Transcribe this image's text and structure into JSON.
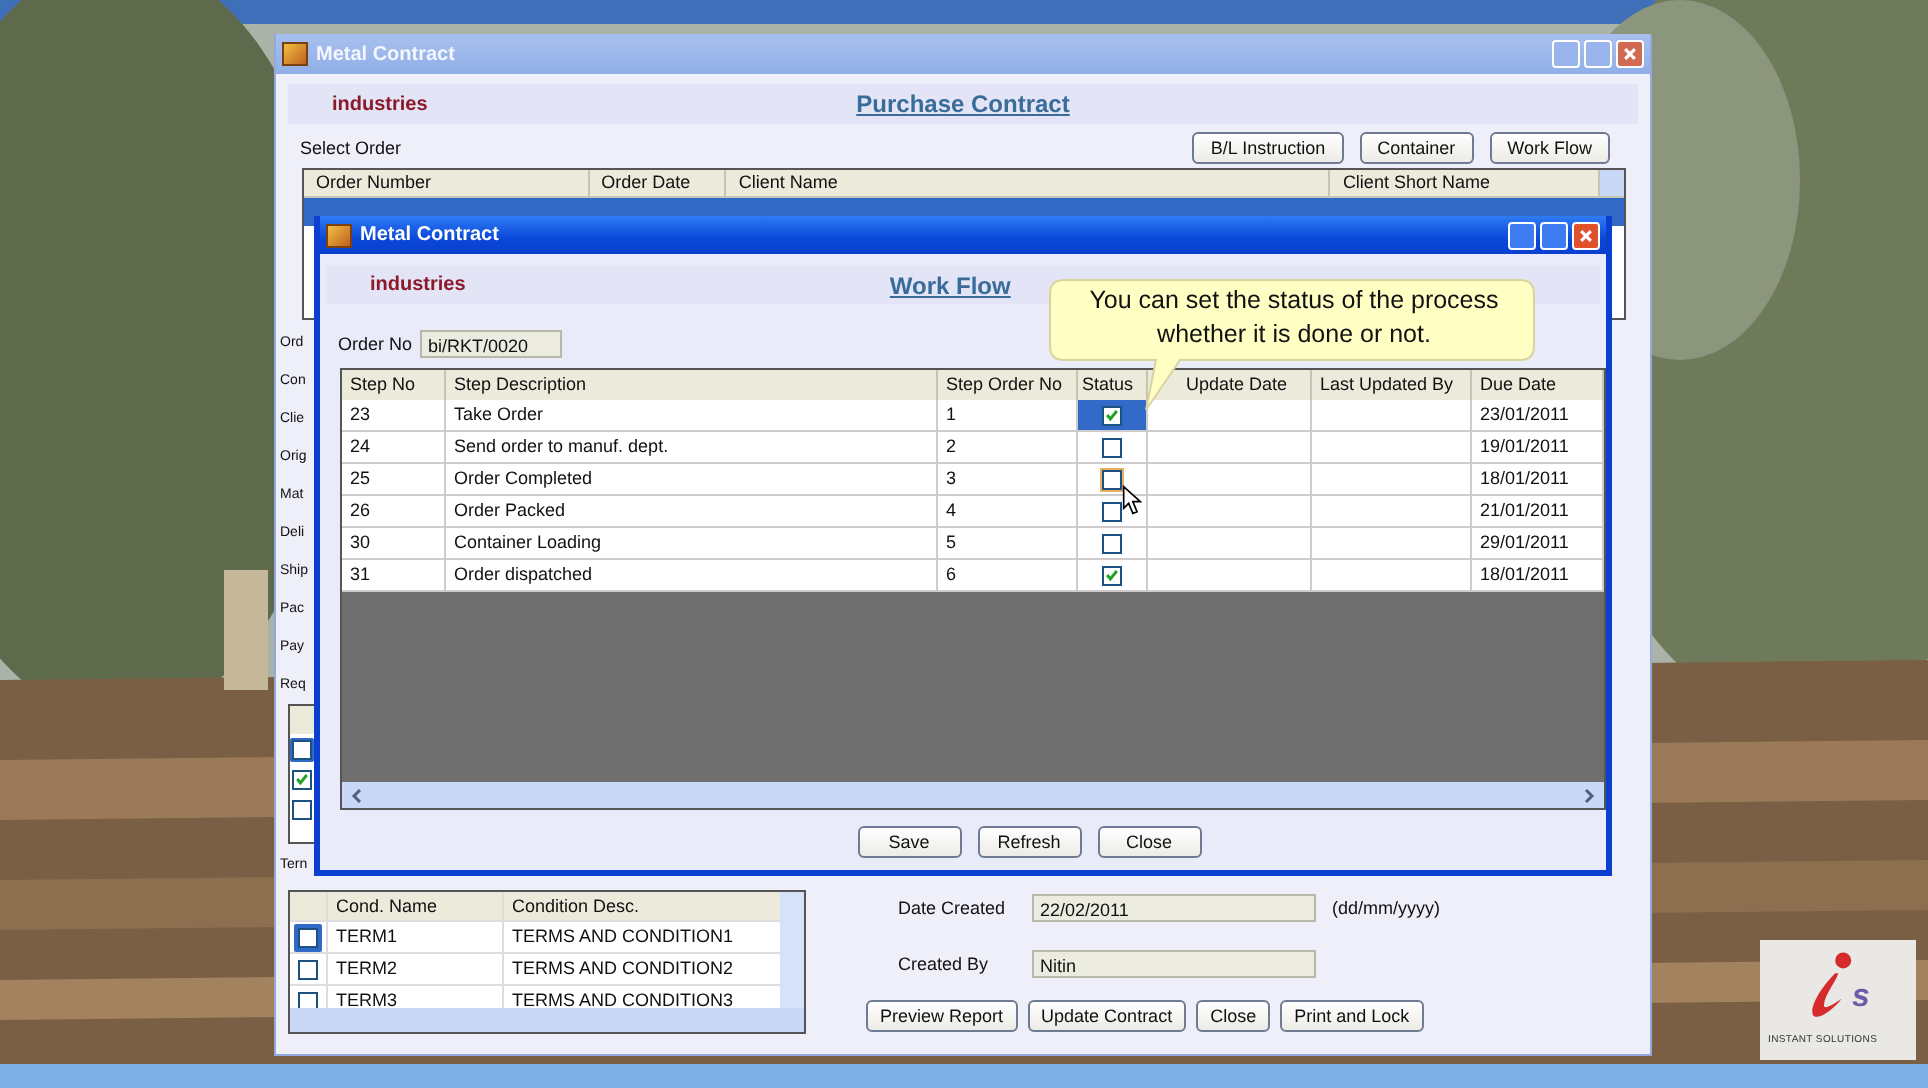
{
  "main_window": {
    "title": "Metal Contract",
    "company": "industries",
    "heading": "Purchase Contract",
    "select_label": "Select Order",
    "top_buttons": [
      "B/L Instruction",
      "Container",
      "Work Flow"
    ],
    "orders_table": {
      "columns": [
        "Order Number",
        "Order Date",
        "Client Name",
        "Client Short Name"
      ],
      "rows": [
        {
          "selected": true
        }
      ]
    },
    "side_labels": [
      "Ord",
      "Con",
      "Clie",
      "Orig",
      "Mat",
      "Deli",
      "Ship",
      "Pac",
      "Pay",
      "Req"
    ],
    "side_grid": [
      {
        "checked": false,
        "selected": true
      },
      {
        "checked": true,
        "selected": false
      },
      {
        "checked": false,
        "selected": false
      }
    ],
    "terms_label": "Tern",
    "terms_table": {
      "columns": [
        "Cond. Name",
        "Condition Desc."
      ],
      "rows": [
        {
          "name": "TERM1",
          "desc": "TERMS AND CONDITION1",
          "checked": false,
          "selected": true
        },
        {
          "name": "TERM2",
          "desc": "TERMS AND CONDITION2",
          "checked": false,
          "selected": false
        },
        {
          "name": "TERM3",
          "desc": "TERMS AND CONDITION3",
          "checked": false,
          "selected": false
        }
      ]
    },
    "date_created": {
      "label": "Date Created",
      "value": "22/02/2011",
      "hint": "(dd/mm/yyyy)"
    },
    "created_by": {
      "label": "Created By",
      "value": "Nitin"
    },
    "bottom_buttons": [
      "Preview Report",
      "Update Contract",
      "Close",
      "Print and Lock"
    ]
  },
  "dialog": {
    "title": "Metal Contract",
    "company": "industries",
    "heading": "Work Flow",
    "order_no": {
      "label": "Order No",
      "value": "bi/RKT/0020"
    },
    "table": {
      "columns": [
        "Step No",
        "Step Description",
        "Step Order No",
        "Status",
        "Update Date",
        "Last Updated By",
        "Due Date"
      ],
      "rows": [
        {
          "step_no": "23",
          "description": "Take Order",
          "order": "1",
          "done": true,
          "selected": true,
          "hovered": false,
          "due": "23/01/2011"
        },
        {
          "step_no": "24",
          "description": "Send order to manuf. dept.",
          "order": "2",
          "done": false,
          "selected": false,
          "hovered": false,
          "due": "19/01/2011"
        },
        {
          "step_no": "25",
          "description": "Order Completed",
          "order": "3",
          "done": false,
          "selected": false,
          "hovered": true,
          "due": "18/01/2011"
        },
        {
          "step_no": "26",
          "description": "Order Packed",
          "order": "4",
          "done": false,
          "selected": false,
          "hovered": false,
          "due": "21/01/2011"
        },
        {
          "step_no": "30",
          "description": "Container Loading",
          "order": "5",
          "done": false,
          "selected": false,
          "hovered": false,
          "due": "29/01/2011"
        },
        {
          "step_no": "31",
          "description": "Order dispatched",
          "order": "6",
          "done": true,
          "selected": false,
          "hovered": false,
          "due": "18/01/2011"
        }
      ]
    },
    "buttons": [
      "Save",
      "Refresh",
      "Close"
    ]
  },
  "tooltip": {
    "text": "You can set the status of the process whether it is done or not."
  },
  "logo": {
    "letter": "s",
    "tagline": "INSTANT SOLUTIONS"
  }
}
